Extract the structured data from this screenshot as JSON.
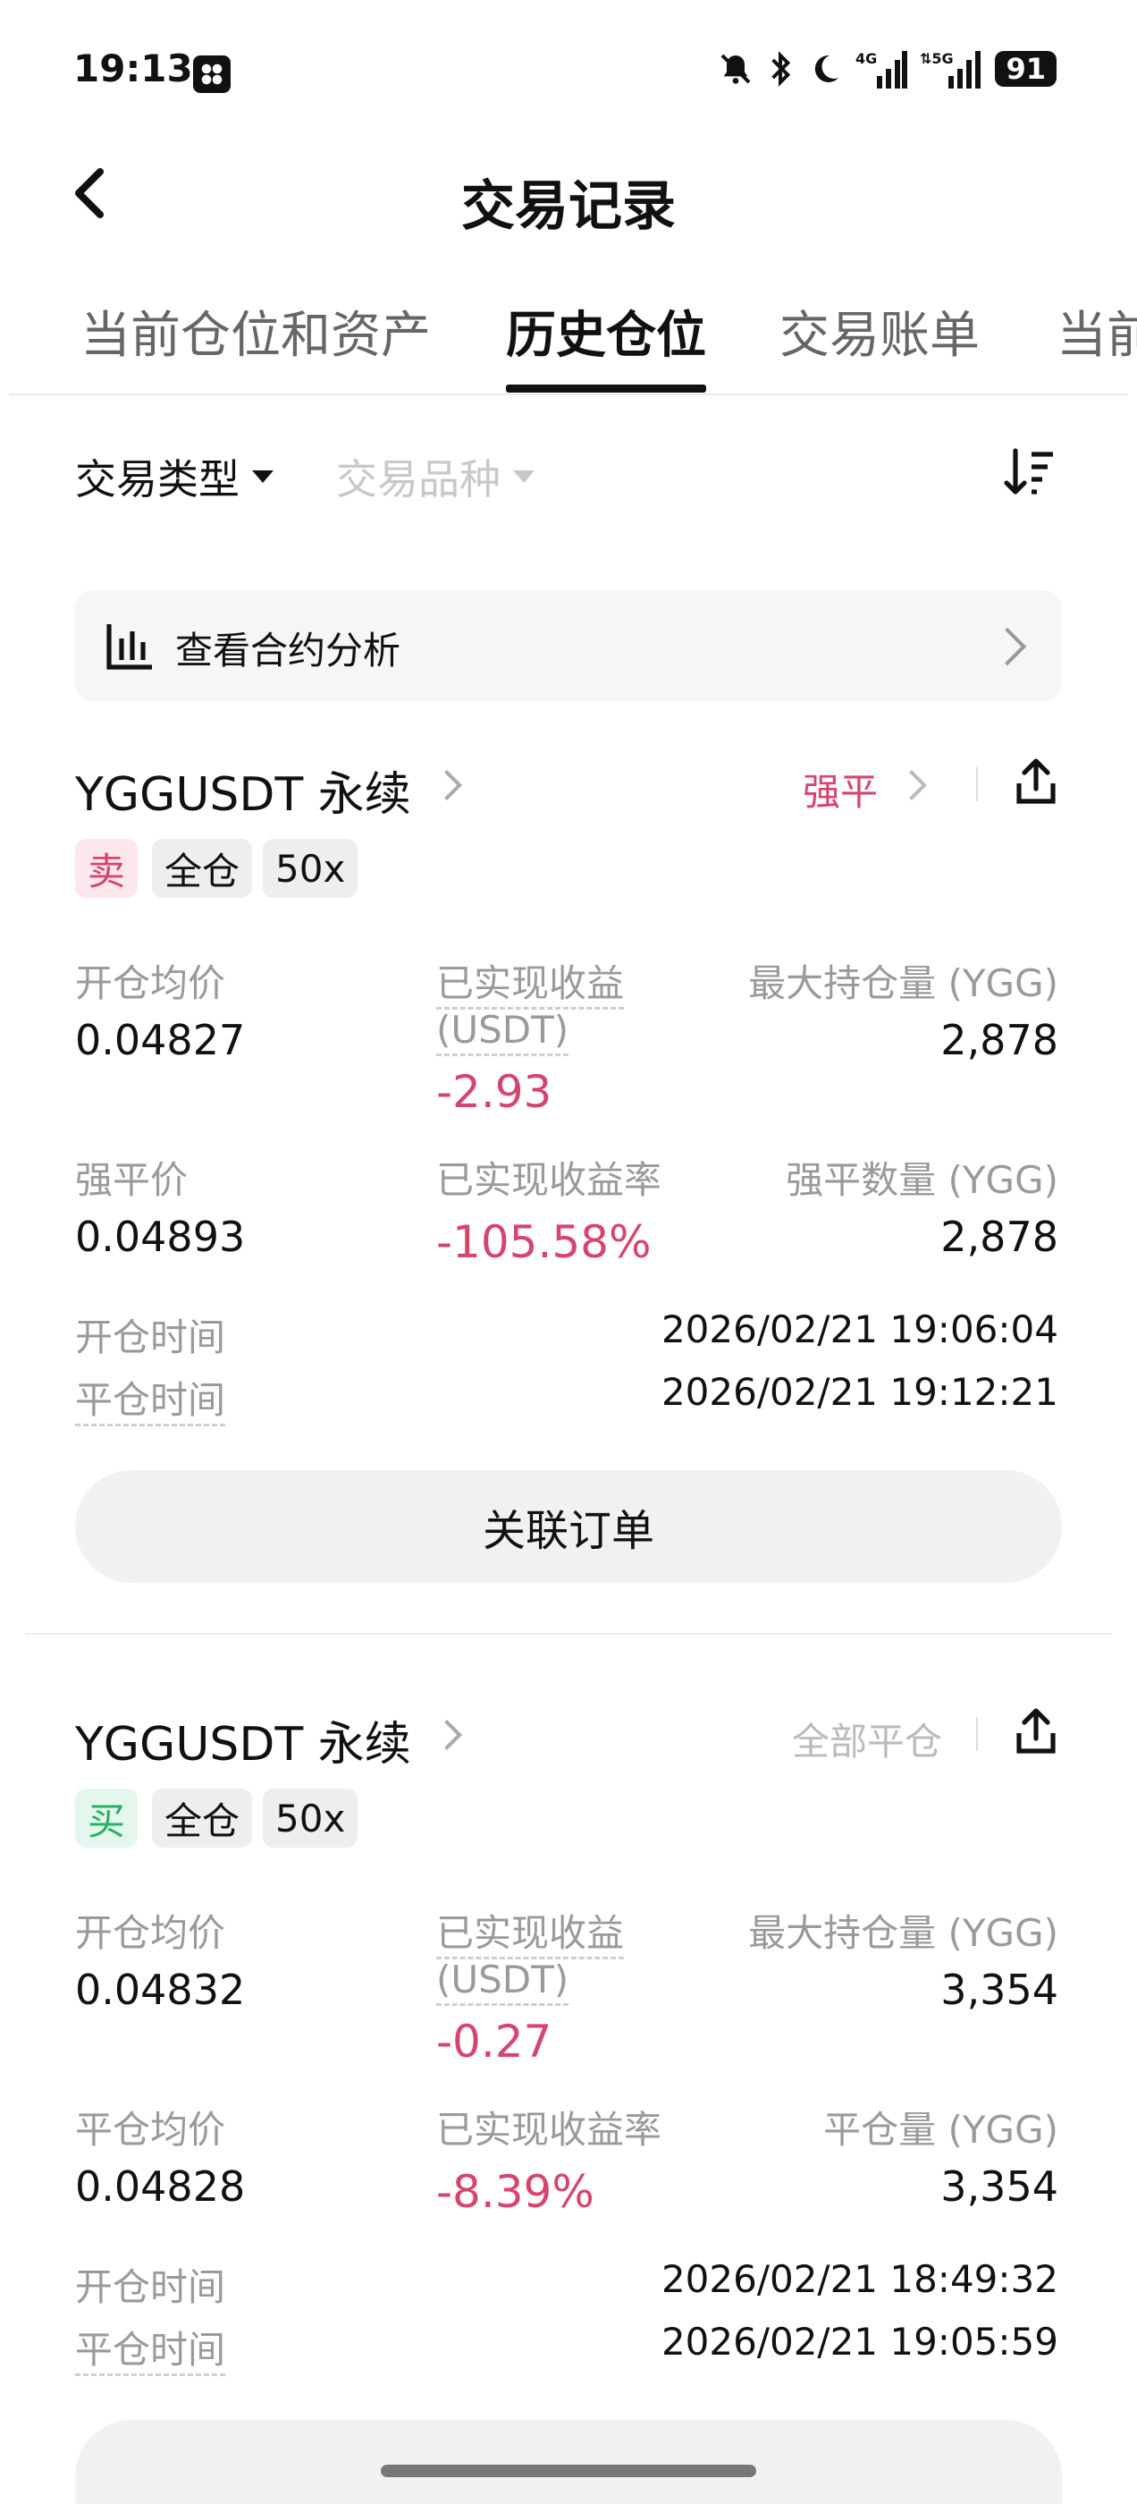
{
  "status_bar": {
    "time": "19:13",
    "battery": "91",
    "icons": [
      "bell-off-icon",
      "bluetooth-icon",
      "moon-icon",
      "4g-signal-icon",
      "5g-signal-icon",
      "battery-icon"
    ]
  },
  "header": {
    "title": "交易记录"
  },
  "tabs": [
    {
      "label": "当前仓位和资产",
      "active": false
    },
    {
      "label": "历史仓位",
      "active": true
    },
    {
      "label": "交易账单",
      "active": false
    },
    {
      "label": "当前",
      "active": false
    }
  ],
  "filters": {
    "trade_type": "交易类型",
    "trade_symbol": "交易品种"
  },
  "banner": {
    "label": "查看合约分析"
  },
  "positions": [
    {
      "symbol": "YGGUSDT 永续",
      "close_type": "强平",
      "tags": [
        "卖",
        "全仓",
        "50x"
      ],
      "labels": {
        "open_avg": "开仓均价",
        "realized_pnl": "已实现收益",
        "realized_unit": "(USDT)",
        "max_position": "最大持仓量 (YGG)",
        "second_price": "强平价",
        "realized_rate": "已实现收益率",
        "second_qty": "强平数量 (YGG)",
        "open_time": "开仓时间",
        "close_time": "平仓时间"
      },
      "open_avg": "0.04827",
      "realized_pnl": "-2.93",
      "max_position": "2,878",
      "second_price": "0.04893",
      "realized_rate": "-105.58%",
      "second_qty": "2,878",
      "open_time": "2026/02/21 19:06:04",
      "close_time": "2026/02/21 19:12:21",
      "linked_orders": "关联订单"
    },
    {
      "symbol": "YGGUSDT 永续",
      "close_type": "全部平仓",
      "tags": [
        "买",
        "全仓",
        "50x"
      ],
      "labels": {
        "open_avg": "开仓均价",
        "realized_pnl": "已实现收益",
        "realized_unit": "(USDT)",
        "max_position": "最大持仓量 (YGG)",
        "second_price": "平仓均价",
        "realized_rate": "已实现收益率",
        "second_qty": "平仓量 (YGG)",
        "open_time": "开仓时间",
        "close_time": "平仓时间"
      },
      "open_avg": "0.04832",
      "realized_pnl": "-0.27",
      "max_position": "3,354",
      "second_price": "0.04828",
      "realized_rate": "-8.39%",
      "second_qty": "3,354",
      "open_time": "2026/02/21 18:49:32",
      "close_time": "2026/02/21 19:05:59"
    }
  ],
  "colors": {
    "negative": "#d6456d",
    "sell_bg": "#fde8ee",
    "buy": "#27b066",
    "buy_bg": "#e5f7ec"
  }
}
